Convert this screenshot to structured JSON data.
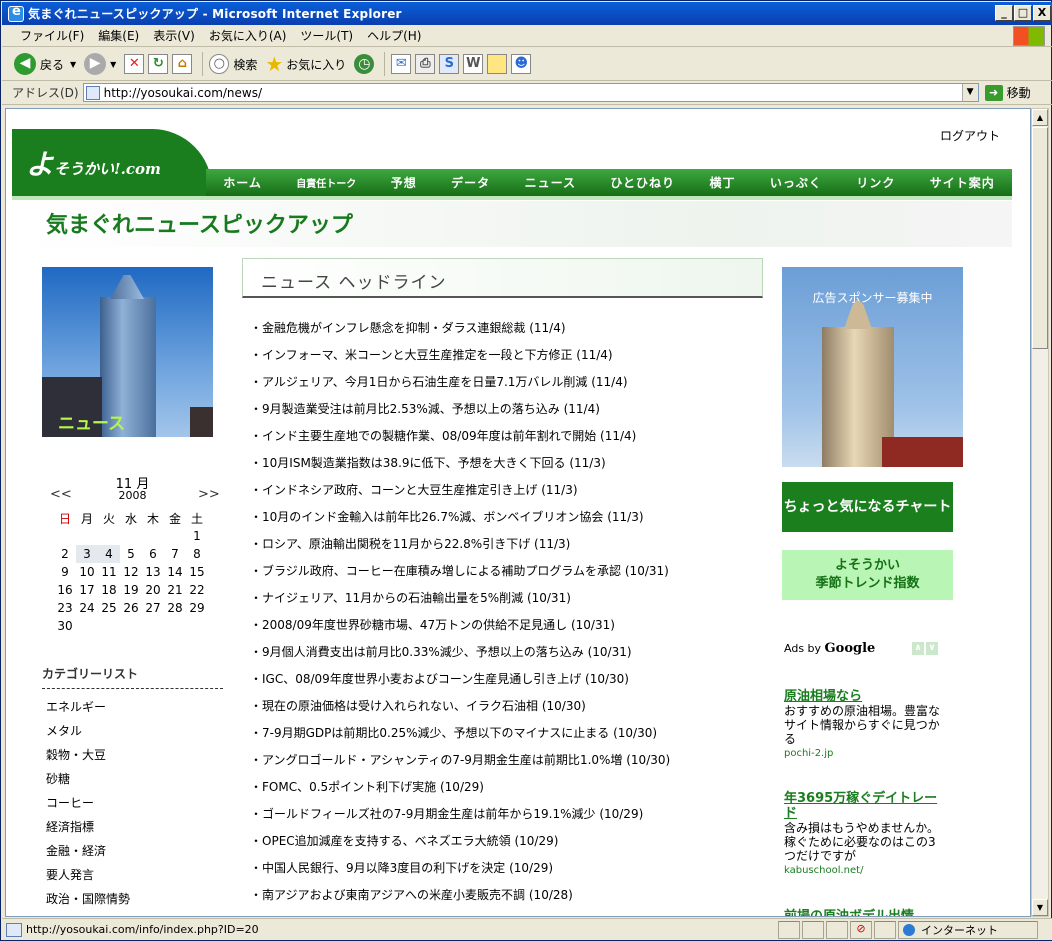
{
  "window": {
    "title": "気まぐれニュースピックアップ - Microsoft Internet Explorer",
    "minimize": "_",
    "maximize": "□",
    "close": "X"
  },
  "menu": [
    "ファイル(F)",
    "編集(E)",
    "表示(V)",
    "お気に入り(A)",
    "ツール(T)",
    "ヘルプ(H)"
  ],
  "toolbar": {
    "back": "戻る",
    "search": "検索",
    "favorites": "お気に入り"
  },
  "address": {
    "label": "アドレス(D)",
    "url": "http://yosoukai.com/news/",
    "go": "移動"
  },
  "site": {
    "logout": "ログアウト",
    "logo_main": "よ",
    "logo_sub": "そうかい!.com",
    "nav": [
      "ホーム",
      "自責任トーク",
      "予想",
      "データ",
      "ニュース",
      "ひとひねり",
      "横丁",
      "いっぷく",
      "リンク",
      "サイト案内"
    ],
    "page_title": "気まぐれニュースピックアップ",
    "news_image_label": "ニュース"
  },
  "calendar": {
    "month": "11 月",
    "year": "2008",
    "prev": "<<",
    "next": ">>",
    "weekdays": [
      "日",
      "月",
      "火",
      "水",
      "木",
      "金",
      "土"
    ],
    "weeks": [
      [
        "",
        "",
        "",
        "",
        "",
        "",
        "1"
      ],
      [
        "2",
        "3",
        "4",
        "5",
        "6",
        "7",
        "8"
      ],
      [
        "9",
        "10",
        "11",
        "12",
        "13",
        "14",
        "15"
      ],
      [
        "16",
        "17",
        "18",
        "19",
        "20",
        "21",
        "22"
      ],
      [
        "23",
        "24",
        "25",
        "26",
        "27",
        "28",
        "29"
      ],
      [
        "30",
        "",
        "",
        "",
        "",
        "",
        ""
      ]
    ]
  },
  "categories": {
    "heading": "カテゴリーリスト",
    "items": [
      "エネルギー",
      "メタル",
      "穀物・大豆",
      "砂糖",
      "コーヒー",
      "経済指標",
      "金融・経済",
      "要人発言",
      "政治・国際情勢"
    ]
  },
  "headline": {
    "title": "ニュース ヘッドライン",
    "items": [
      "金融危機がインフレ懸念を抑制・ダラス連銀総裁 (11/4)",
      "インフォーマ、米コーンと大豆生産推定を一段と下方修正 (11/4)",
      "アルジェリア、今月1日から石油生産を日量7.1万バレル削減 (11/4)",
      "9月製造業受注は前月比2.53%減、予想以上の落ち込み (11/4)",
      "インド主要生産地での製糖作業、08/09年度は前年割れで開始 (11/4)",
      "10月ISM製造業指数は38.9に低下、予想を大きく下回る (11/3)",
      "インドネシア政府、コーンと大豆生産推定引き上げ (11/3)",
      "10月のインド金輸入は前年比26.7%減、ボンベイブリオン協会 (11/3)",
      "ロシア、原油輸出関税を11月から22.8%引き下げ (11/3)",
      "ブラジル政府、コーヒー在庫積み増しによる補助プログラムを承認 (10/31)",
      "ナイジェリア、11月からの石油輸出量を5%削減 (10/31)",
      "2008/09年度世界砂糖市場、47万トンの供給不足見通し (10/31)",
      "9月個人消費支出は前月比0.33%減少、予想以上の落ち込み (10/31)",
      "IGC、08/09年度世界小麦およびコーン生産見通し引き上げ (10/30)",
      "現在の原油価格は受け入れられない、イラク石油相 (10/30)",
      "7-9月期GDPは前期比0.25%減少、予想以下のマイナスに止まる (10/30)",
      "アングロゴールド・アシャンティの7-9月期金生産は前期比1.0%増 (10/30)",
      "FOMC、0.5ポイント利下げ実施 (10/29)",
      "ゴールドフィールズ社の7-9月期金生産は前年から19.1%減少 (10/29)",
      "OPEC追加減産を支持する、ベネズエラ大統領 (10/29)",
      "中国人民銀行、9月以降3度目の利下げを決定 (10/29)",
      "南アジアおよび東南アジアへの米産小麦販売不調 (10/28)"
    ]
  },
  "sidebar_right": {
    "ad_caption": "広告スポンサー募集中",
    "chart_button": "ちょっと気になるチャート",
    "trend_button_1": "よそうかい",
    "trend_button_2": "季節トレンド指数",
    "ads_by": "Ads by",
    "google": "Google",
    "ads": [
      {
        "title": "原油相場なら",
        "desc": "おすすめの原油相場。豊富なサイト情報からすぐに見つかる",
        "url": "pochi-2.jp"
      },
      {
        "title": "年3695万稼ぐデイトレード",
        "desc": "含み損はもうやめませんか。稼ぐために必要なのはこの3つだけですが",
        "url": "kabuschool.net/"
      },
      {
        "title": "前場の原油ボデル出情",
        "desc": "",
        "url": ""
      }
    ]
  },
  "status": {
    "text": "http://yosoukai.com/info/index.php?ID=20",
    "zone": "インターネット"
  }
}
